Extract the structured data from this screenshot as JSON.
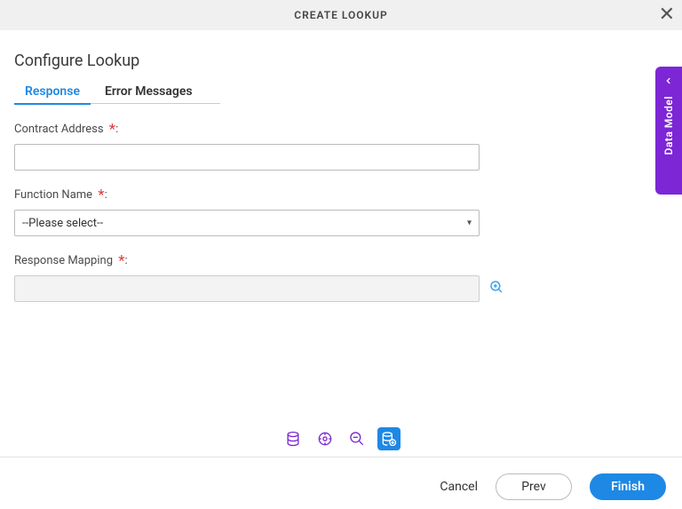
{
  "header": {
    "title": "CREATE LOOKUP"
  },
  "section": {
    "heading": "Configure Lookup"
  },
  "tabs": {
    "response": "Response",
    "error_messages": "Error Messages"
  },
  "fields": {
    "contract_address": {
      "label": "Contract Address",
      "value": ""
    },
    "function_name": {
      "label": "Function Name",
      "placeholder": "--Please select--"
    },
    "response_mapping": {
      "label": "Response Mapping",
      "value": ""
    }
  },
  "side_tab": {
    "label": "Data Model"
  },
  "footer": {
    "cancel": "Cancel",
    "prev": "Prev",
    "finish": "Finish"
  }
}
